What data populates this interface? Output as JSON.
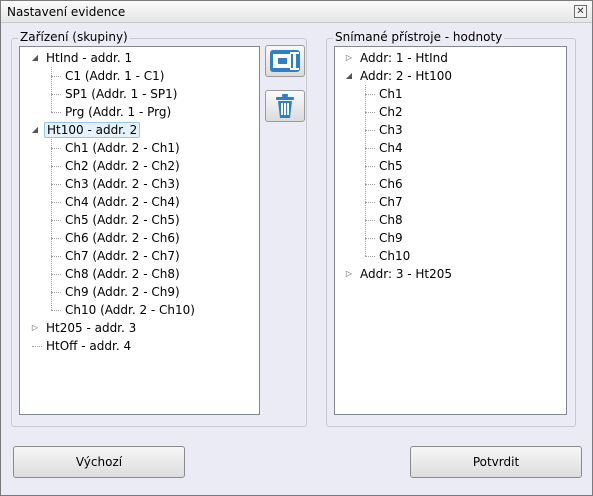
{
  "window": {
    "title": "Nastavení evidence",
    "close_glyph": "✕"
  },
  "left_panel": {
    "title": "Zařízení (skupiny)",
    "tree": [
      {
        "label": "HtInd - addr. 1",
        "expanded": true,
        "children": [
          "C1 (Addr. 1 - C1)",
          "SP1 (Addr. 1 - SP1)",
          "Prg (Addr. 1 - Prg)"
        ]
      },
      {
        "label": "Ht100 - addr. 2",
        "expanded": true,
        "selected": true,
        "children": [
          "Ch1 (Addr. 2 - Ch1)",
          "Ch2 (Addr. 2 - Ch2)",
          "Ch3 (Addr. 2 - Ch3)",
          "Ch4 (Addr. 2 - Ch4)",
          "Ch5 (Addr. 2 - Ch5)",
          "Ch6 (Addr. 2 - Ch6)",
          "Ch7 (Addr. 2 - Ch7)",
          "Ch8 (Addr. 2 - Ch8)",
          "Ch9 (Addr. 2 - Ch9)",
          "Ch10 (Addr. 2 - Ch10)"
        ]
      },
      {
        "label": "Ht205 - addr. 3",
        "expanded": false,
        "children": []
      },
      {
        "label": "HtOff - addr. 4",
        "expanded": false,
        "leaf": true,
        "children": []
      }
    ]
  },
  "toolbar": {
    "move_icon": "move-to-group-icon",
    "delete_icon": "trash-icon"
  },
  "right_panel": {
    "title": "Snímané přístroje - hodnoty",
    "tree": [
      {
        "label": "Addr: 1 - HtInd",
        "expanded": false,
        "children": []
      },
      {
        "label": "Addr: 2 - Ht100",
        "expanded": true,
        "children": [
          "Ch1",
          "Ch2",
          "Ch3",
          "Ch4",
          "Ch5",
          "Ch6",
          "Ch7",
          "Ch8",
          "Ch9",
          "Ch10"
        ]
      },
      {
        "label": "Addr: 3 - Ht205",
        "expanded": false,
        "children": []
      }
    ]
  },
  "buttons": {
    "default_label": "Výchozí",
    "confirm_label": "Potvrdit"
  }
}
